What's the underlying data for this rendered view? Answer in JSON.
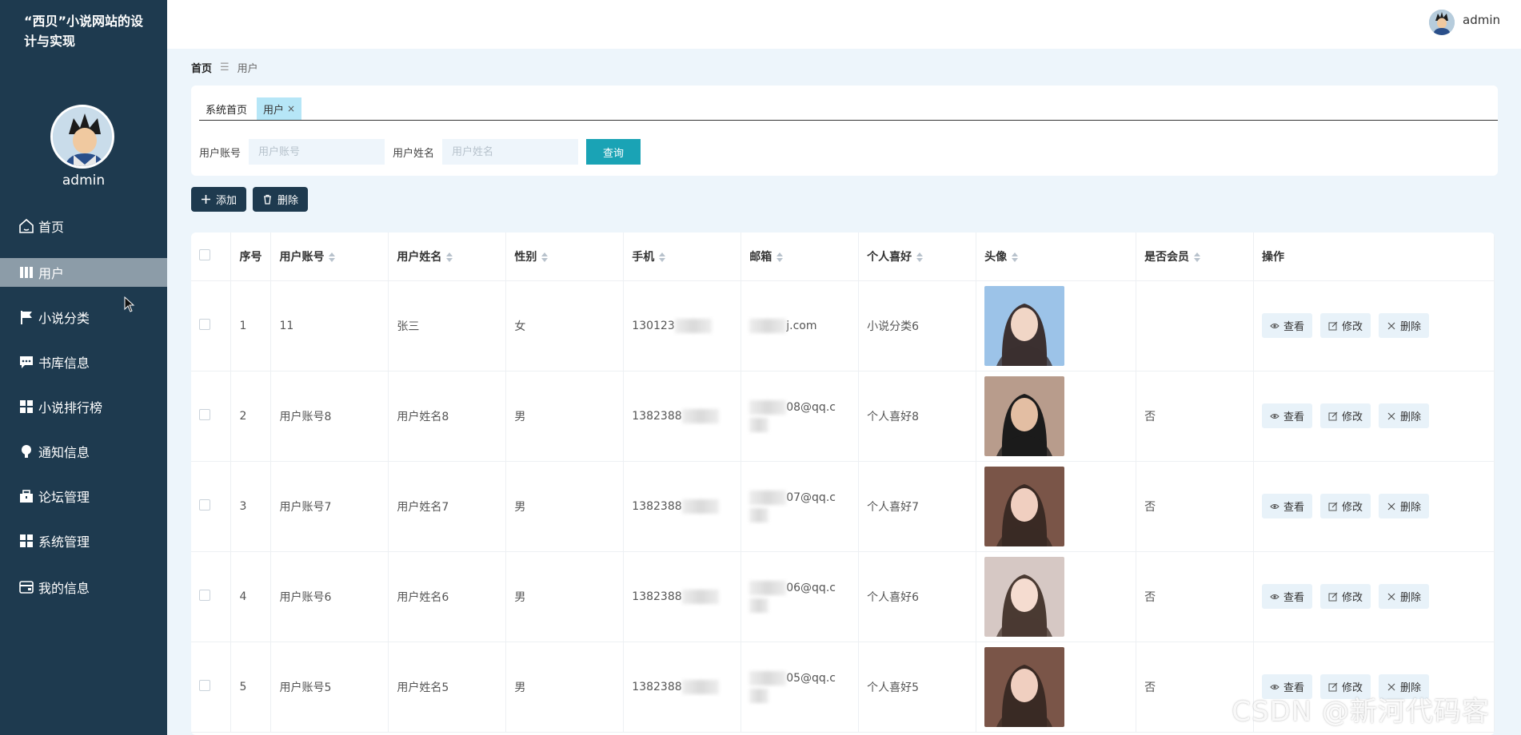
{
  "app": {
    "title": "“西贝”小说网站的设计与实现",
    "username": "admin"
  },
  "sidebar": {
    "username": "admin",
    "items": [
      {
        "label": "首页",
        "icon": "home-icon",
        "active": false
      },
      {
        "label": "用户",
        "icon": "book-icon",
        "active": true
      },
      {
        "label": "小说分类",
        "icon": "flag-icon",
        "active": false
      },
      {
        "label": "书库信息",
        "icon": "chat-icon",
        "active": false
      },
      {
        "label": "小说排行榜",
        "icon": "grid-icon",
        "active": false
      },
      {
        "label": "通知信息",
        "icon": "bulb-icon",
        "active": false
      },
      {
        "label": "论坛管理",
        "icon": "briefcase-icon",
        "active": false
      },
      {
        "label": "系统管理",
        "icon": "grid-icon",
        "active": false
      },
      {
        "label": "我的信息",
        "icon": "wallet-icon",
        "active": false
      }
    ]
  },
  "breadcrumb": {
    "home": "首页",
    "separator": "☰",
    "current": "用户"
  },
  "tabs": [
    {
      "label": "系统首页"
    },
    {
      "label": "用户",
      "closable": true,
      "close": "×"
    }
  ],
  "search": {
    "account_label": "用户账号",
    "account_placeholder": "用户账号",
    "name_label": "用户姓名",
    "name_placeholder": "用户姓名",
    "query_button": "查询"
  },
  "toolbar": {
    "add_label": "添加",
    "delete_label": "删除"
  },
  "table": {
    "headers": [
      "序号",
      "用户账号",
      "用户姓名",
      "性别",
      "手机",
      "邮箱",
      "个人喜好",
      "头像",
      "是否会员",
      "操作"
    ],
    "actions": {
      "view": "查看",
      "edit": "修改",
      "delete": "删除"
    },
    "rows": [
      {
        "index": "1",
        "account": "11",
        "name": "张三",
        "gender": "女",
        "phone": "130123",
        "email": "j.com",
        "hobby": "小说分类6",
        "member": ""
      },
      {
        "index": "2",
        "account": "用户账号8",
        "name": "用户姓名8",
        "gender": "男",
        "phone": "1382388",
        "email": "08@qq.c",
        "hobby": "个人喜好8",
        "member": "否"
      },
      {
        "index": "3",
        "account": "用户账号7",
        "name": "用户姓名7",
        "gender": "男",
        "phone": "1382388",
        "email": "07@qq.c",
        "hobby": "个人喜好7",
        "member": "否"
      },
      {
        "index": "4",
        "account": "用户账号6",
        "name": "用户姓名6",
        "gender": "男",
        "phone": "1382388",
        "email": "06@qq.c",
        "hobby": "个人喜好6",
        "member": "否"
      },
      {
        "index": "5",
        "account": "用户账号5",
        "name": "用户姓名5",
        "gender": "男",
        "phone": "1382388",
        "email": "05@qq.c",
        "hobby": "个人喜好5",
        "member": "否"
      }
    ]
  },
  "watermark": "CSDN @新河代码客",
  "colors": {
    "sidebar": "#1e3a4f",
    "active_item": "#8c9ca8",
    "query_button": "#1aa3b5",
    "page_bg": "#edf5fb"
  }
}
